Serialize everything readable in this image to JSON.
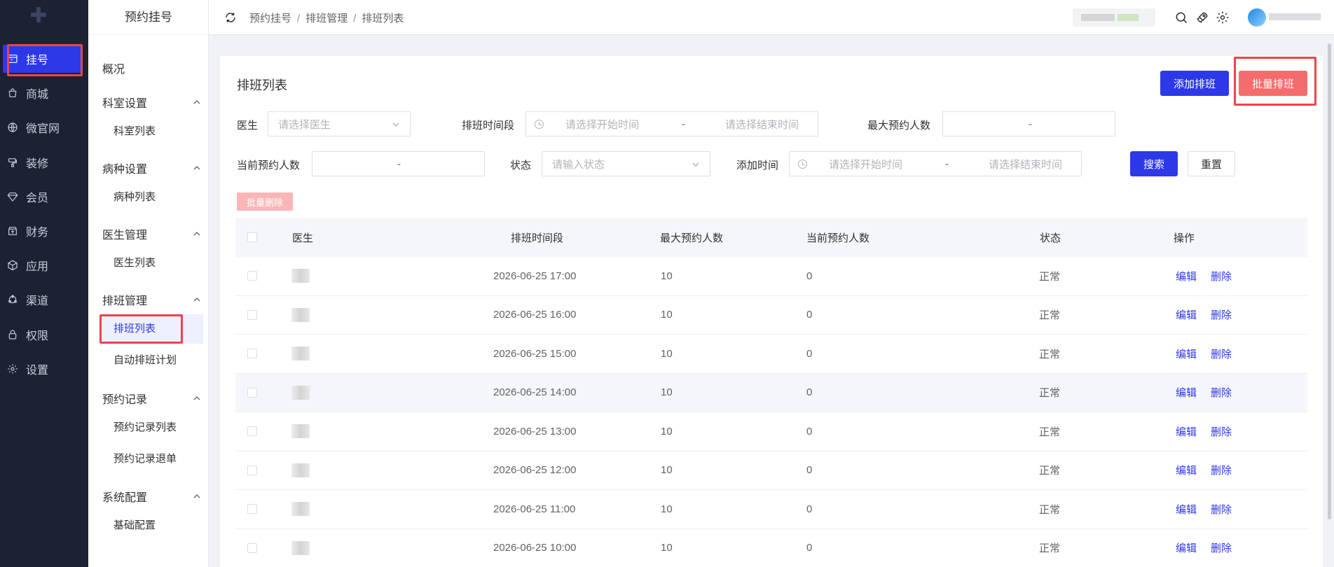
{
  "nav": {
    "items": [
      {
        "label": "挂号",
        "icon": "register-icon",
        "active": true
      },
      {
        "label": "商城",
        "icon": "shopping-bag-icon"
      },
      {
        "label": "微官网",
        "icon": "globe-icon"
      },
      {
        "label": "装修",
        "icon": "decorate-icon"
      },
      {
        "label": "会员",
        "icon": "diamond-icon"
      },
      {
        "label": "财务",
        "icon": "finance-icon"
      },
      {
        "label": "应用",
        "icon": "cube-icon"
      },
      {
        "label": "渠道",
        "icon": "channel-icon"
      },
      {
        "label": "权限",
        "icon": "lock-icon"
      },
      {
        "label": "设置",
        "icon": "gear-icon"
      }
    ]
  },
  "subnav": {
    "title": "预约挂号",
    "overview": "概况",
    "groups": [
      {
        "label": "科室设置",
        "items": [
          "科室列表"
        ]
      },
      {
        "label": "病种设置",
        "items": [
          "病种列表"
        ]
      },
      {
        "label": "医生管理",
        "items": [
          "医生列表"
        ]
      },
      {
        "label": "排班管理",
        "items": [
          "排班列表",
          "自动排班计划"
        ]
      },
      {
        "label": "预约记录",
        "items": [
          "预约记录列表",
          "预约记录退单"
        ]
      },
      {
        "label": "系统配置",
        "items": [
          "基础配置"
        ]
      }
    ],
    "active_item": "排班列表"
  },
  "breadcrumb": [
    "预约挂号",
    "排班管理",
    "排班列表"
  ],
  "card": {
    "title": "排班列表",
    "add_button": "添加排班",
    "batch_button": "批量排班",
    "batch_delete": "批量删除"
  },
  "filters": {
    "doctor_label": "医生",
    "doctor_placeholder": "请选择医生",
    "period_label": "排班时间段",
    "period_start": "请选择开始时间",
    "period_end": "请选择结束时间",
    "max_label": "最大预约人数",
    "current_label": "当前预约人数",
    "status_label": "状态",
    "status_placeholder": "请输入状态",
    "added_label": "添加时间",
    "added_start": "请选择开始时间",
    "added_end": "请选择结束时间",
    "range_sep": "-",
    "search": "搜索",
    "reset": "重置"
  },
  "table": {
    "headers": [
      "医生",
      "排班时间段",
      "最大预约人数",
      "当前预约人数",
      "状态",
      "操作"
    ],
    "rows": [
      {
        "time": "2026-06-25 17:00",
        "max": "10",
        "current": "0",
        "status": "正常"
      },
      {
        "time": "2026-06-25 16:00",
        "max": "10",
        "current": "0",
        "status": "正常"
      },
      {
        "time": "2026-06-25 15:00",
        "max": "10",
        "current": "0",
        "status": "正常"
      },
      {
        "time": "2026-06-25 14:00",
        "max": "10",
        "current": "0",
        "status": "正常"
      },
      {
        "time": "2026-06-25 13:00",
        "max": "10",
        "current": "0",
        "status": "正常"
      },
      {
        "time": "2026-06-25 12:00",
        "max": "10",
        "current": "0",
        "status": "正常"
      },
      {
        "time": "2026-06-25 11:00",
        "max": "10",
        "current": "0",
        "status": "正常"
      },
      {
        "time": "2026-06-25 10:00",
        "max": "10",
        "current": "0",
        "status": "正常"
      }
    ],
    "edit": "编辑",
    "delete": "删除"
  },
  "colors": {
    "primary": "#2d38e8",
    "danger": "#f56c6c",
    "highlight": "#e9454b",
    "sidebar": "#1d2134"
  }
}
